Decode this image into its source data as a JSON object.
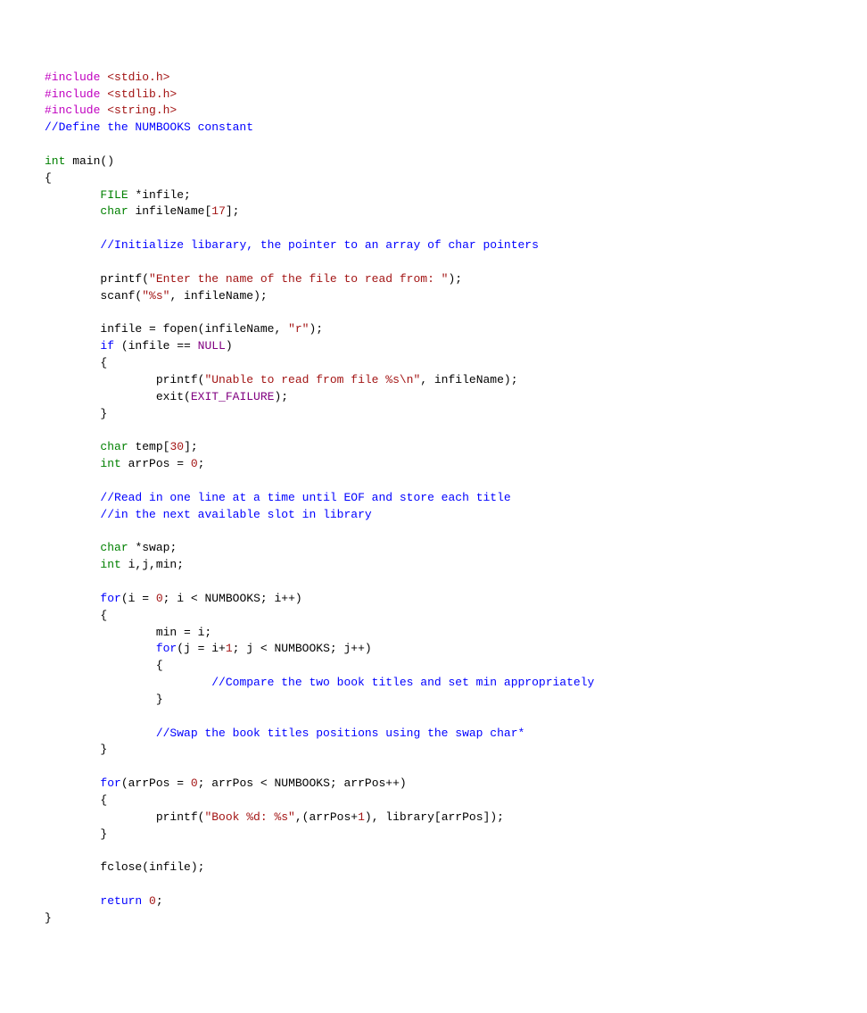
{
  "code": {
    "include1_hash": "#include ",
    "include1_target": "<stdio.h>",
    "include2_hash": "#include ",
    "include2_target": "<stdlib.h>",
    "include3_hash": "#include ",
    "include3_target": "<string.h>",
    "comment_define": "//Define the NUMBOOKS constant",
    "kw_int": "int",
    "main_name": " main()",
    "brace_open": "{",
    "type_file": "FILE",
    "infile_decl": " *infile;",
    "type_char": "char",
    "infile_name_decl": " infileName[",
    "infile_name_size": "17",
    "infile_name_end": "];",
    "comment_init": "//Initialize libarary, the pointer to an array of char pointers",
    "printf1_a": "printf(",
    "printf1_str": "\"Enter the name of the file to read from: \"",
    "printf1_b": ");",
    "scanf_a": "scanf(",
    "scanf_str": "\"%s\"",
    "scanf_b": ", infileName);",
    "fopen_a": "infile = fopen(infileName, ",
    "fopen_str": "\"r\"",
    "fopen_b": ");",
    "kw_if": "if",
    "if_cond_a": " (infile == ",
    "null_macro": "NULL",
    "if_cond_b": ")",
    "printf2_a": "printf(",
    "printf2_str": "\"Unable to read from file %s\\n\"",
    "printf2_b": ", infileName);",
    "exit_a": "exit(",
    "exit_macro": "EXIT_FAILURE",
    "exit_b": ");",
    "temp_decl_a": " temp[",
    "temp_size": "30",
    "temp_decl_b": "];",
    "arrpos_decl_a": " arrPos = ",
    "zero": "0",
    "semi": ";",
    "comment_read1": "//Read in one line at a time until EOF and store each title",
    "comment_read2": "//in the next available slot in library",
    "swap_decl": " *swap;",
    "ijmin_decl": " i,j,min;",
    "kw_for": "for",
    "for1_a": "(i = ",
    "for1_b": "; i < NUMBOOKS; i++)",
    "min_assign": "min = i;",
    "for2_a": "(j = i+",
    "one": "1",
    "for2_b": "; j < NUMBOOKS; j++)",
    "comment_compare": "//Compare the two book titles and set min appropriately",
    "comment_swap": "//Swap the book titles positions using the swap char*",
    "for3_a": "(arrPos = ",
    "for3_b": "; arrPos < NUMBOOKS; arrPos++)",
    "printf3_a": "printf(",
    "printf3_str": "\"Book %d: %s\"",
    "printf3_b": ",(arrPos+",
    "printf3_c": "), library[arrPos]);",
    "fclose": "fclose(infile);",
    "kw_return": "return",
    "return_tail": " ",
    "brace_close": "}"
  }
}
